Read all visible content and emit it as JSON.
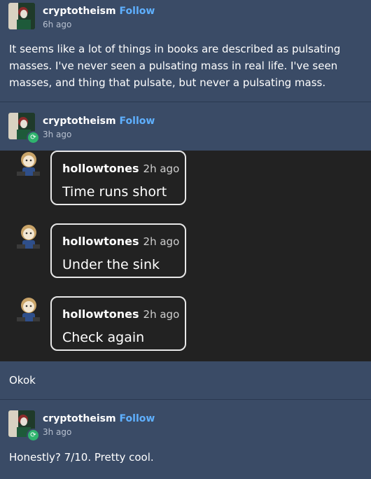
{
  "posts": [
    {
      "username": "cryptotheism",
      "follow_label": "Follow",
      "time": "6h ago",
      "text": "It seems like a lot of things in books are described as pulsating masses. I've never seen a pulsating mass in real life. I've seen masses, and thing that pulsate, but never a pulsating mass."
    },
    {
      "username": "cryptotheism",
      "follow_label": "Follow",
      "time": "3h ago"
    },
    {
      "text": "Okok"
    },
    {
      "username": "cryptotheism",
      "follow_label": "Follow",
      "time": "3h ago",
      "text": "Honestly? 7/10. Pretty cool."
    }
  ],
  "messages": [
    {
      "name": "hollowtones",
      "time": "2h ago",
      "text": "Time runs short"
    },
    {
      "name": "hollowtones",
      "time": "2h ago",
      "text": "Under the sink"
    },
    {
      "name": "hollowtones",
      "time": "2h ago",
      "text": "Check again"
    }
  ],
  "icons": {
    "reblog": "reblog-icon",
    "avatar": "user-avatar"
  },
  "colors": {
    "background": "#3a4b66",
    "dark_panel": "#222222",
    "follow": "#5fb0ff",
    "reblog_badge": "#2fb36e"
  }
}
